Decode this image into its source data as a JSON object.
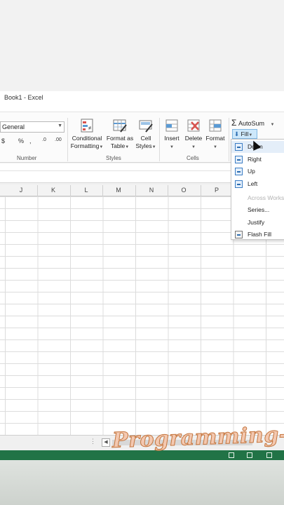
{
  "window": {
    "title": "Book1 - Excel"
  },
  "ribbon": {
    "number_format": {
      "value": "General"
    },
    "number_buttons": {
      "accounting": "$",
      "percent": "%",
      "comma": ",",
      "inc_decimal": ".0",
      "dec_decimal": ".00"
    },
    "groups": {
      "number": "Number",
      "styles": "Styles",
      "cells": "Cells"
    },
    "buttons": {
      "conditional_formatting": [
        "Conditional",
        "Formatting"
      ],
      "format_as_table": [
        "Format as",
        "Table"
      ],
      "cell_styles": [
        "Cell",
        "Styles"
      ],
      "insert": "Insert",
      "delete": "Delete",
      "format": "Format",
      "autosum": "AutoSum",
      "fill": "Fill"
    }
  },
  "columns": [
    "J",
    "K",
    "L",
    "M",
    "N",
    "O",
    "P"
  ],
  "fill_menu": {
    "items": [
      {
        "label": "Down",
        "state": "hover"
      },
      {
        "label": "Right",
        "state": "normal"
      },
      {
        "label": "Up",
        "state": "normal"
      },
      {
        "label": "Left",
        "state": "normal"
      },
      {
        "label": "Across Works",
        "state": "disabled"
      },
      {
        "label": "Series...",
        "state": "normal"
      },
      {
        "label": "Justify",
        "state": "normal"
      },
      {
        "label": "Flash Fill",
        "state": "normal"
      }
    ]
  },
  "watermark": "Programming-W",
  "colors": {
    "excel_green": "#217346",
    "accent_blue": "#2b6cb0"
  }
}
